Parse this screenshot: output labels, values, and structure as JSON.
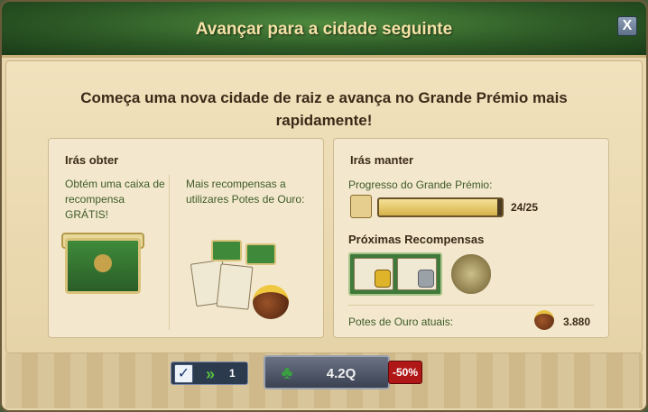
{
  "dialog": {
    "title": "Avançar para a cidade seguinte",
    "close_label": "X",
    "headline": "Começa uma nova cidade de raiz e avança no Grande Prémio mais rapidamente!"
  },
  "obtain": {
    "title": "Irás obter",
    "free_chest_text": "Obtém uma caixa de recompensa GRÁTIS!",
    "gold_pots_text": "Mais recompensas a utilizares Potes de Ouro:"
  },
  "keep": {
    "title": "Irás manter",
    "progress_label": "Progresso do Grande Prémio:",
    "progress_current": 24,
    "progress_total": 25,
    "progress_text": "24/25",
    "next_rewards_label": "Próximas Recompensas",
    "pots_label": "Potes de Ouro atuais:",
    "pots_value": "3.880"
  },
  "footer": {
    "toggle_checked": true,
    "toggle_count": "1",
    "advance_label": "4.2Q",
    "discount": "-50%"
  },
  "icons": {
    "checkbox": "✓",
    "boost": "»",
    "clover": "♣"
  }
}
